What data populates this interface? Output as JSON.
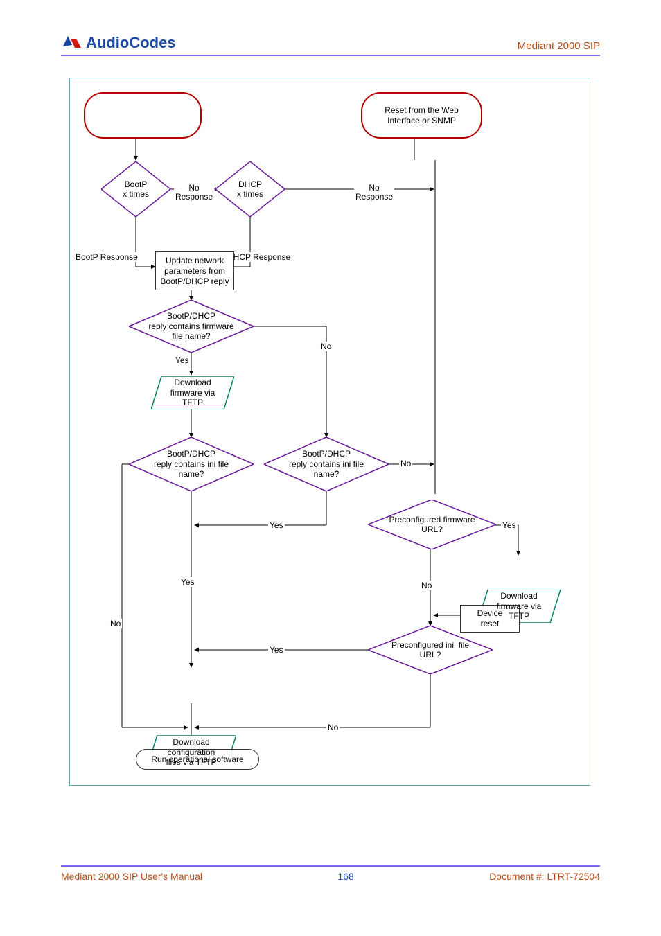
{
  "brand": "AudioCodes",
  "header_right": "Mediant 2000 SIP",
  "footer_left": "Mediant 2000 SIP User's Manual",
  "footer_mid": "168",
  "footer_right": "Document #: LTRT-72504",
  "shapes": {
    "start_reset_web": "Reset from the Web Interface or SNMP",
    "bootp_xtimes": "BootP\nx times",
    "dhcp_xtimes": "DHCP\nx times",
    "update_net": "Update network\nparameters from\nBootP/DHCP reply",
    "bootp_firm_q": "BootP/DHCP\nreply contains firmware\nfile name?",
    "dl_firm_tftp": "Download\nfirmware via\nTFTP",
    "bootp_ini_q_l": "BootP/DHCP\nreply contains ini file\nname?",
    "bootp_ini_q_r": "BootP/DHCP\nreply contains ini file\nname?",
    "preconf_firm_url": "Preconfigured firmware\nURL?",
    "dl_firm_tftp2": "Download\nfirmware via\nTFTP",
    "device_reset": "Device\nreset",
    "preconf_ini_url": "Preconfigured ini  file\nURL?",
    "dl_conf_tftp": "Download\nconfiguration\nfiles via TFTP",
    "run_sw": "Run operational software"
  },
  "labels": {
    "no": "No",
    "yes": "Yes",
    "no_response": "No\nResponse",
    "bootp_response": "BootP Response",
    "dhcp_response": "DHCP Response"
  }
}
